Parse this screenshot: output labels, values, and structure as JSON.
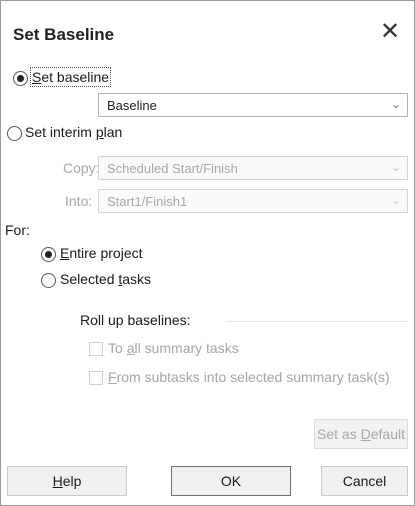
{
  "dialog": {
    "title": "Set Baseline",
    "close_glyph": "✕"
  },
  "set_baseline": {
    "label": "Set baseline",
    "label_underline_char": "S",
    "label_rest": "et baseline",
    "selected": true,
    "dropdown_value": "Baseline"
  },
  "set_interim": {
    "label_prefix": "Set interim ",
    "label_u": "p",
    "label_rest": "lan",
    "selected": false,
    "copy_label": "Copy:",
    "copy_value": "Scheduled Start/Finish",
    "into_label": "Into:",
    "into_value": "Start1/Finish1"
  },
  "for": {
    "label": "For:",
    "entire_project_u": "E",
    "entire_project_rest": "ntire project",
    "entire_project_selected": true,
    "selected_tasks_prefix": "Selected ",
    "selected_tasks_u": "t",
    "selected_tasks_rest": "asks",
    "selected_tasks_selected": false
  },
  "rollup": {
    "heading": "Roll up baselines:",
    "to_all_prefix": "To ",
    "to_all_u": "a",
    "to_all_rest": "ll summary tasks",
    "from_sub_u": "F",
    "from_sub_rest": "rom subtasks into selected summary task(s)"
  },
  "buttons": {
    "set_default_prefix": "Set as ",
    "set_default_u": "D",
    "set_default_rest": "efault",
    "help_u": "H",
    "help_rest": "elp",
    "ok": "OK",
    "cancel": "Cancel"
  },
  "icons": {
    "chevron": "⌄"
  },
  "colors": {
    "disabled_text": "#a6a6a6",
    "border": "#9a9a9a"
  }
}
